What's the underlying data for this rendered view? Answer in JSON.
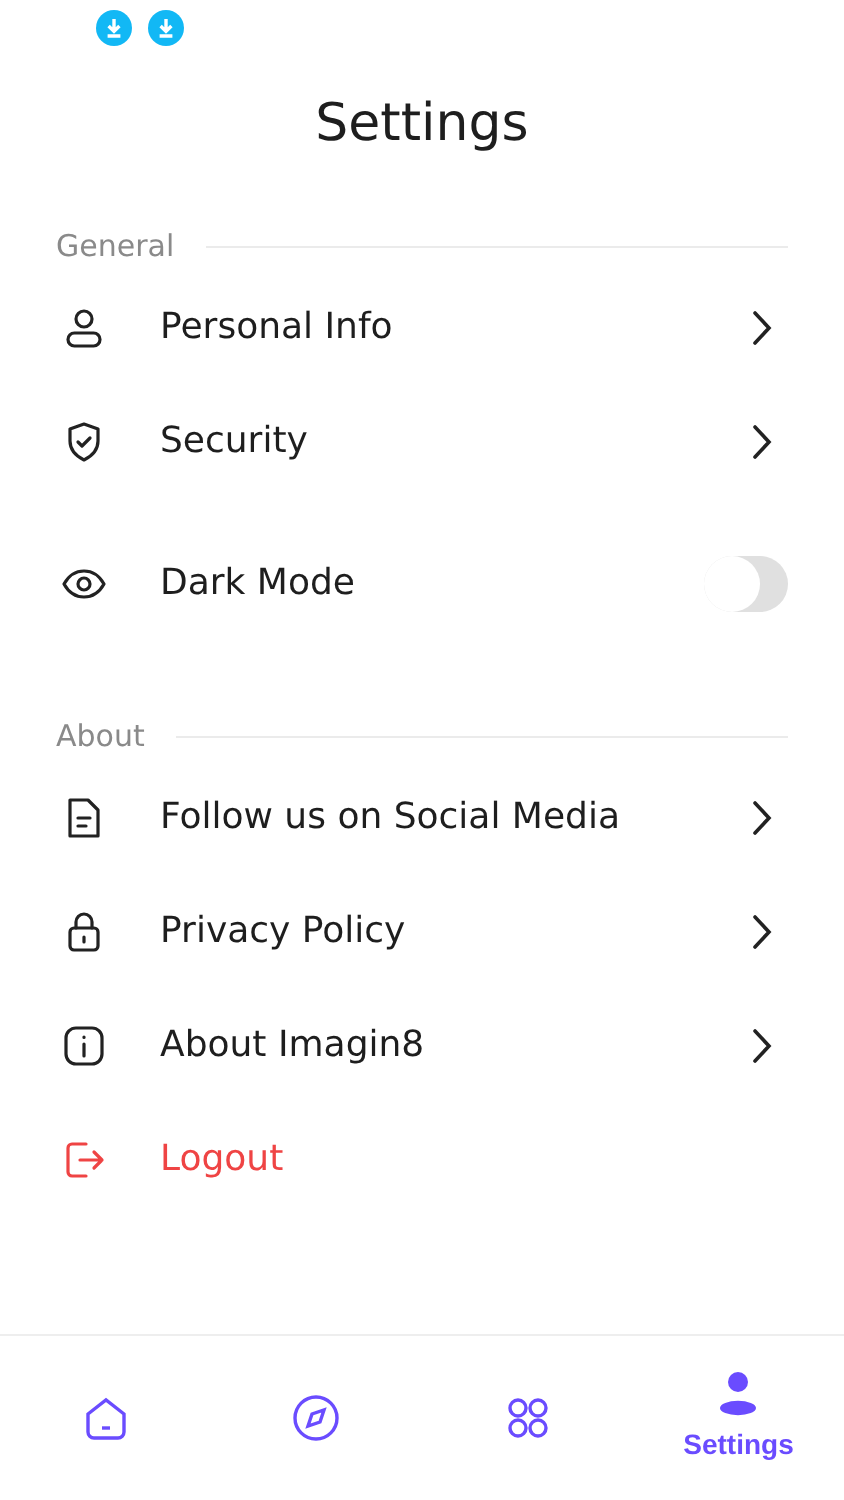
{
  "status_bar": {
    "notifications": [
      {
        "kind": "download"
      },
      {
        "kind": "download"
      }
    ]
  },
  "title": "Settings",
  "sections": [
    {
      "heading": "General",
      "items": [
        {
          "kind": "link",
          "label": "Personal Info"
        },
        {
          "kind": "link",
          "label": "Security"
        },
        {
          "kind": "toggle",
          "label": "Dark Mode",
          "on": false
        }
      ]
    },
    {
      "heading": "About",
      "items": [
        {
          "kind": "link",
          "label": "Follow us on Social Media"
        },
        {
          "kind": "link",
          "label": "Privacy Policy"
        },
        {
          "kind": "link",
          "label": "About Imagin8"
        },
        {
          "kind": "logout",
          "label": "Logout"
        }
      ]
    }
  ],
  "nav": [
    {
      "selected": false
    },
    {
      "selected": false
    },
    {
      "selected": false
    },
    {
      "selected": true,
      "label": "Settings"
    }
  ]
}
